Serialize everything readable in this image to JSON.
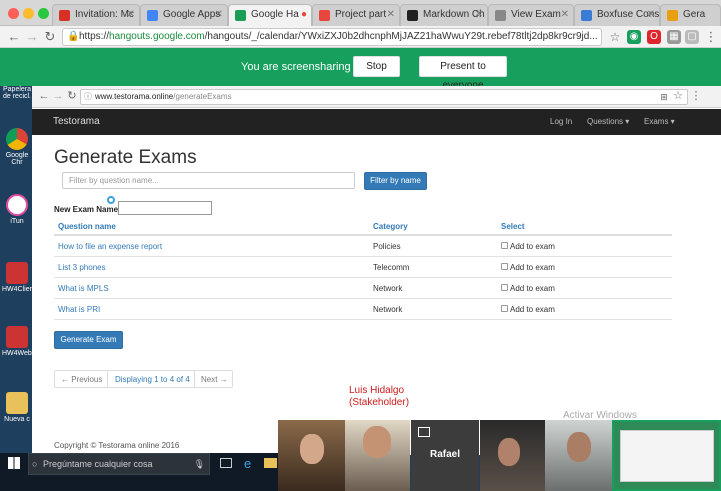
{
  "browser": {
    "tabs": [
      {
        "label": "Invitation: Mc",
        "color": "#d93025"
      },
      {
        "label": "Google Apps",
        "color": "#4285f4"
      },
      {
        "label": "Google Ha",
        "color": "#1a9e55"
      },
      {
        "label": "Project part",
        "color": "#e8453c"
      },
      {
        "label": "Markdown Ch",
        "color": "#222222"
      },
      {
        "label": "View Exam",
        "color": "#888888"
      },
      {
        "label": "Boxfuse Cons",
        "color": "#3a7bd5"
      },
      {
        "label": "Gera",
        "color": "#e8a010"
      }
    ],
    "url_scheme": "https://",
    "url_host": "hangouts.google.com",
    "url_path": "/hangouts/_/calendar/YWxiZXJ0b2dhcnphMjJAZ21haWwuY29t.rebef78tltj2dp8kr9cr9jd..."
  },
  "screenshare": {
    "message": "You are screensharing",
    "stop_label": "Stop",
    "present_label": "Present to everyone"
  },
  "desktop": {
    "icons": [
      "Papelera de recicl.",
      "Google Chr",
      "iTun",
      "HW4Clien",
      "HW4Webs",
      "Nueva c"
    ],
    "search_placeholder": "Pregúntame cualquier cosa"
  },
  "inner_browser": {
    "url_host": "www.testorama.online",
    "url_path": "/generateExams"
  },
  "app": {
    "brand": "Testorama",
    "nav": {
      "login": "Log In",
      "questions": "Questions ▾",
      "exams": "Exams ▾"
    },
    "title": "Generate Exams",
    "filter_placeholder": "Filter by question name...",
    "filter_button": "Filter by name",
    "exam_name_label": "New Exam Name:",
    "columns": {
      "name": "Question name",
      "category": "Category",
      "select": "Select"
    },
    "rows": [
      {
        "name": "How to file an expense report",
        "category": "Policies",
        "select": "Add to exam"
      },
      {
        "name": "List 3 phones",
        "category": "Telecomm",
        "select": "Add to exam"
      },
      {
        "name": "What is MPLS",
        "category": "Network",
        "select": "Add to exam"
      },
      {
        "name": "What is PRI",
        "category": "Network",
        "select": "Add to exam"
      }
    ],
    "generate_button": "Generate Exam",
    "pager": {
      "prev": "← Previous",
      "status": "Displaying 1 to 4 of 4",
      "next": "Next →"
    },
    "footer": "Copyright © Testorama online 2016"
  },
  "hangout": {
    "presenter_name": "Luis Hidalgo",
    "presenter_role": "(Stakeholder)",
    "participant_label": "Rafael",
    "watermark": "Activar Windows"
  }
}
